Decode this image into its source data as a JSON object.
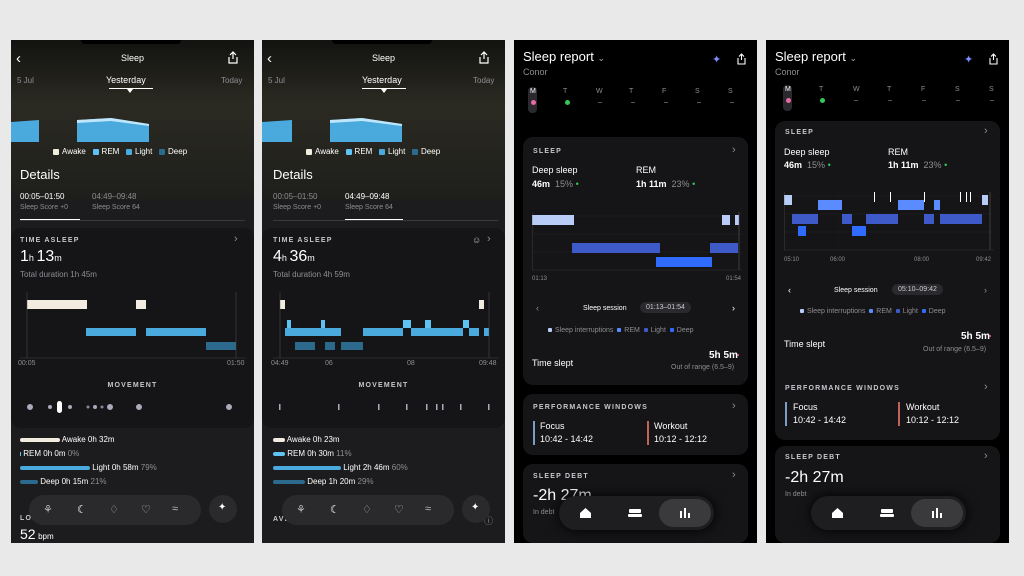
{
  "colors": {
    "awake": "#f2ece0",
    "rem": "#5ec2f2",
    "light": "#4aa9dd",
    "deep": "#2b6a8c",
    "oura_light": "#b9cbf7",
    "oura_mid": "#3d5ac8",
    "oura_deep": "#2f6bff",
    "accent_green": "#34c759",
    "accent_pink": "#e86aa6"
  },
  "phone1": {
    "title": "Sleep",
    "prev_date": "5 Jul",
    "cur_date": "Yesterday",
    "next_date": "Today",
    "legend": [
      "Awake",
      "REM",
      "Light",
      "Deep"
    ],
    "details": "Details",
    "sessions": [
      {
        "time": "00:05–01:50",
        "score": "Sleep Score +0"
      },
      {
        "time": "04:49–09:48",
        "score": "Sleep Score 64"
      }
    ],
    "time_asleep_label": "TIME ASLEEP",
    "asleep": {
      "h": "1",
      "hu": "h",
      "m": "13",
      "mu": "m"
    },
    "total": "Total duration 1h 45m",
    "axis": [
      "00:05",
      "01:50"
    ],
    "movement_label": "MOVEMENT",
    "stages": [
      {
        "name": "Awake",
        "value": "0h 32m",
        "pct": ""
      },
      {
        "name": "REM",
        "value": "0h 0m",
        "pct": "0%"
      },
      {
        "name": "Light",
        "value": "0h 58m",
        "pct": "79%"
      },
      {
        "name": "Deep",
        "value": "0h 15m",
        "pct": "21%"
      }
    ],
    "bottom_label": "LO",
    "bpm_value": "52",
    "bpm_unit": "bpm"
  },
  "phone2": {
    "title": "Sleep",
    "prev_date": "5 Jul",
    "cur_date": "Yesterday",
    "next_date": "Today",
    "legend": [
      "Awake",
      "REM",
      "Light",
      "Deep"
    ],
    "details": "Details",
    "sessions": [
      {
        "time": "00:05–01:50",
        "score": "Sleep Score +0"
      },
      {
        "time": "04:49–09:48",
        "score": "Sleep Score 64"
      }
    ],
    "time_asleep_label": "TIME ASLEEP",
    "asleep": {
      "h": "4",
      "hu": "h",
      "m": "36",
      "mu": "m"
    },
    "total": "Total duration 4h 59m",
    "axis": [
      "04:49",
      "06",
      "08",
      "09:48"
    ],
    "movement_label": "MOVEMENT",
    "stages": [
      {
        "name": "Awake",
        "value": "0h 23m",
        "pct": ""
      },
      {
        "name": "REM",
        "value": "0h 30m",
        "pct": "11%"
      },
      {
        "name": "Light",
        "value": "2h 46m",
        "pct": "60%"
      },
      {
        "name": "Deep",
        "value": "1h 20m",
        "pct": "29%"
      }
    ],
    "bottom_label": "AVERAGE"
  },
  "phone3": {
    "title": "Sleep report",
    "user": "Conor",
    "days": [
      "M",
      "T",
      "W",
      "T",
      "F",
      "S",
      "S"
    ],
    "sleep_label": "SLEEP",
    "deep_label": "Deep sleep",
    "deep_value": "46m",
    "deep_pct": "15%",
    "rem_label": "REM",
    "rem_value": "1h 11m",
    "rem_pct": "23%",
    "axis": [
      "01:13",
      "01:54"
    ],
    "session_label": "Sleep session",
    "session_time": "01:13–01:54",
    "legend": [
      "Sleep interruptions",
      "REM",
      "Light",
      "Deep"
    ],
    "time_slept_label": "Time slept",
    "time_slept": "5h 5m",
    "range": "Out of range (6.5–9)",
    "perf_label": "PERFORMANCE WINDOWS",
    "focus_label": "Focus",
    "focus_time": "10:42 - 14:42",
    "workout_label": "Workout",
    "workout_time": "10:12 - 12:12",
    "debt_label": "SLEEP DEBT",
    "debt_value": "-2h 27m",
    "debt_sub": "In debt"
  },
  "phone4": {
    "title": "Sleep report",
    "user": "Conor",
    "days": [
      "M",
      "T",
      "W",
      "T",
      "F",
      "S",
      "S"
    ],
    "sleep_label": "SLEEP",
    "deep_label": "Deep sleep",
    "deep_value": "46m",
    "deep_pct": "15%",
    "rem_label": "REM",
    "rem_value": "1h 11m",
    "rem_pct": "23%",
    "axis": [
      "05:10",
      "06:00",
      "08:00",
      "09:42"
    ],
    "session_label": "Sleep session",
    "session_time": "05:10–09:42",
    "legend": [
      "Sleep interruptions",
      "REM",
      "Light",
      "Deep"
    ],
    "time_slept_label": "Time slept",
    "time_slept": "5h 5m",
    "range": "Out of range (6.5–9)",
    "perf_label": "PERFORMANCE WINDOWS",
    "focus_label": "Focus",
    "focus_time": "10:42 - 14:42",
    "workout_label": "Workout",
    "workout_time": "10:12 - 12:12",
    "debt_label": "SLEEP DEBT",
    "debt_value": "-2h 27m",
    "debt_sub": "In debt"
  }
}
